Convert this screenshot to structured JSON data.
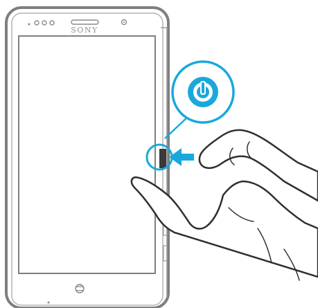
{
  "device": {
    "brand": "SONY",
    "carrier_logo": "att-globe-logo"
  },
  "callout": {
    "icon": "power-icon",
    "arrow_icon": "arrow-left-icon",
    "color": "#1aa8dc"
  },
  "colors": {
    "phone_outline": "#7f7f7f",
    "hand_outline": "#2f2f2f",
    "accent": "#1aa8dc"
  }
}
